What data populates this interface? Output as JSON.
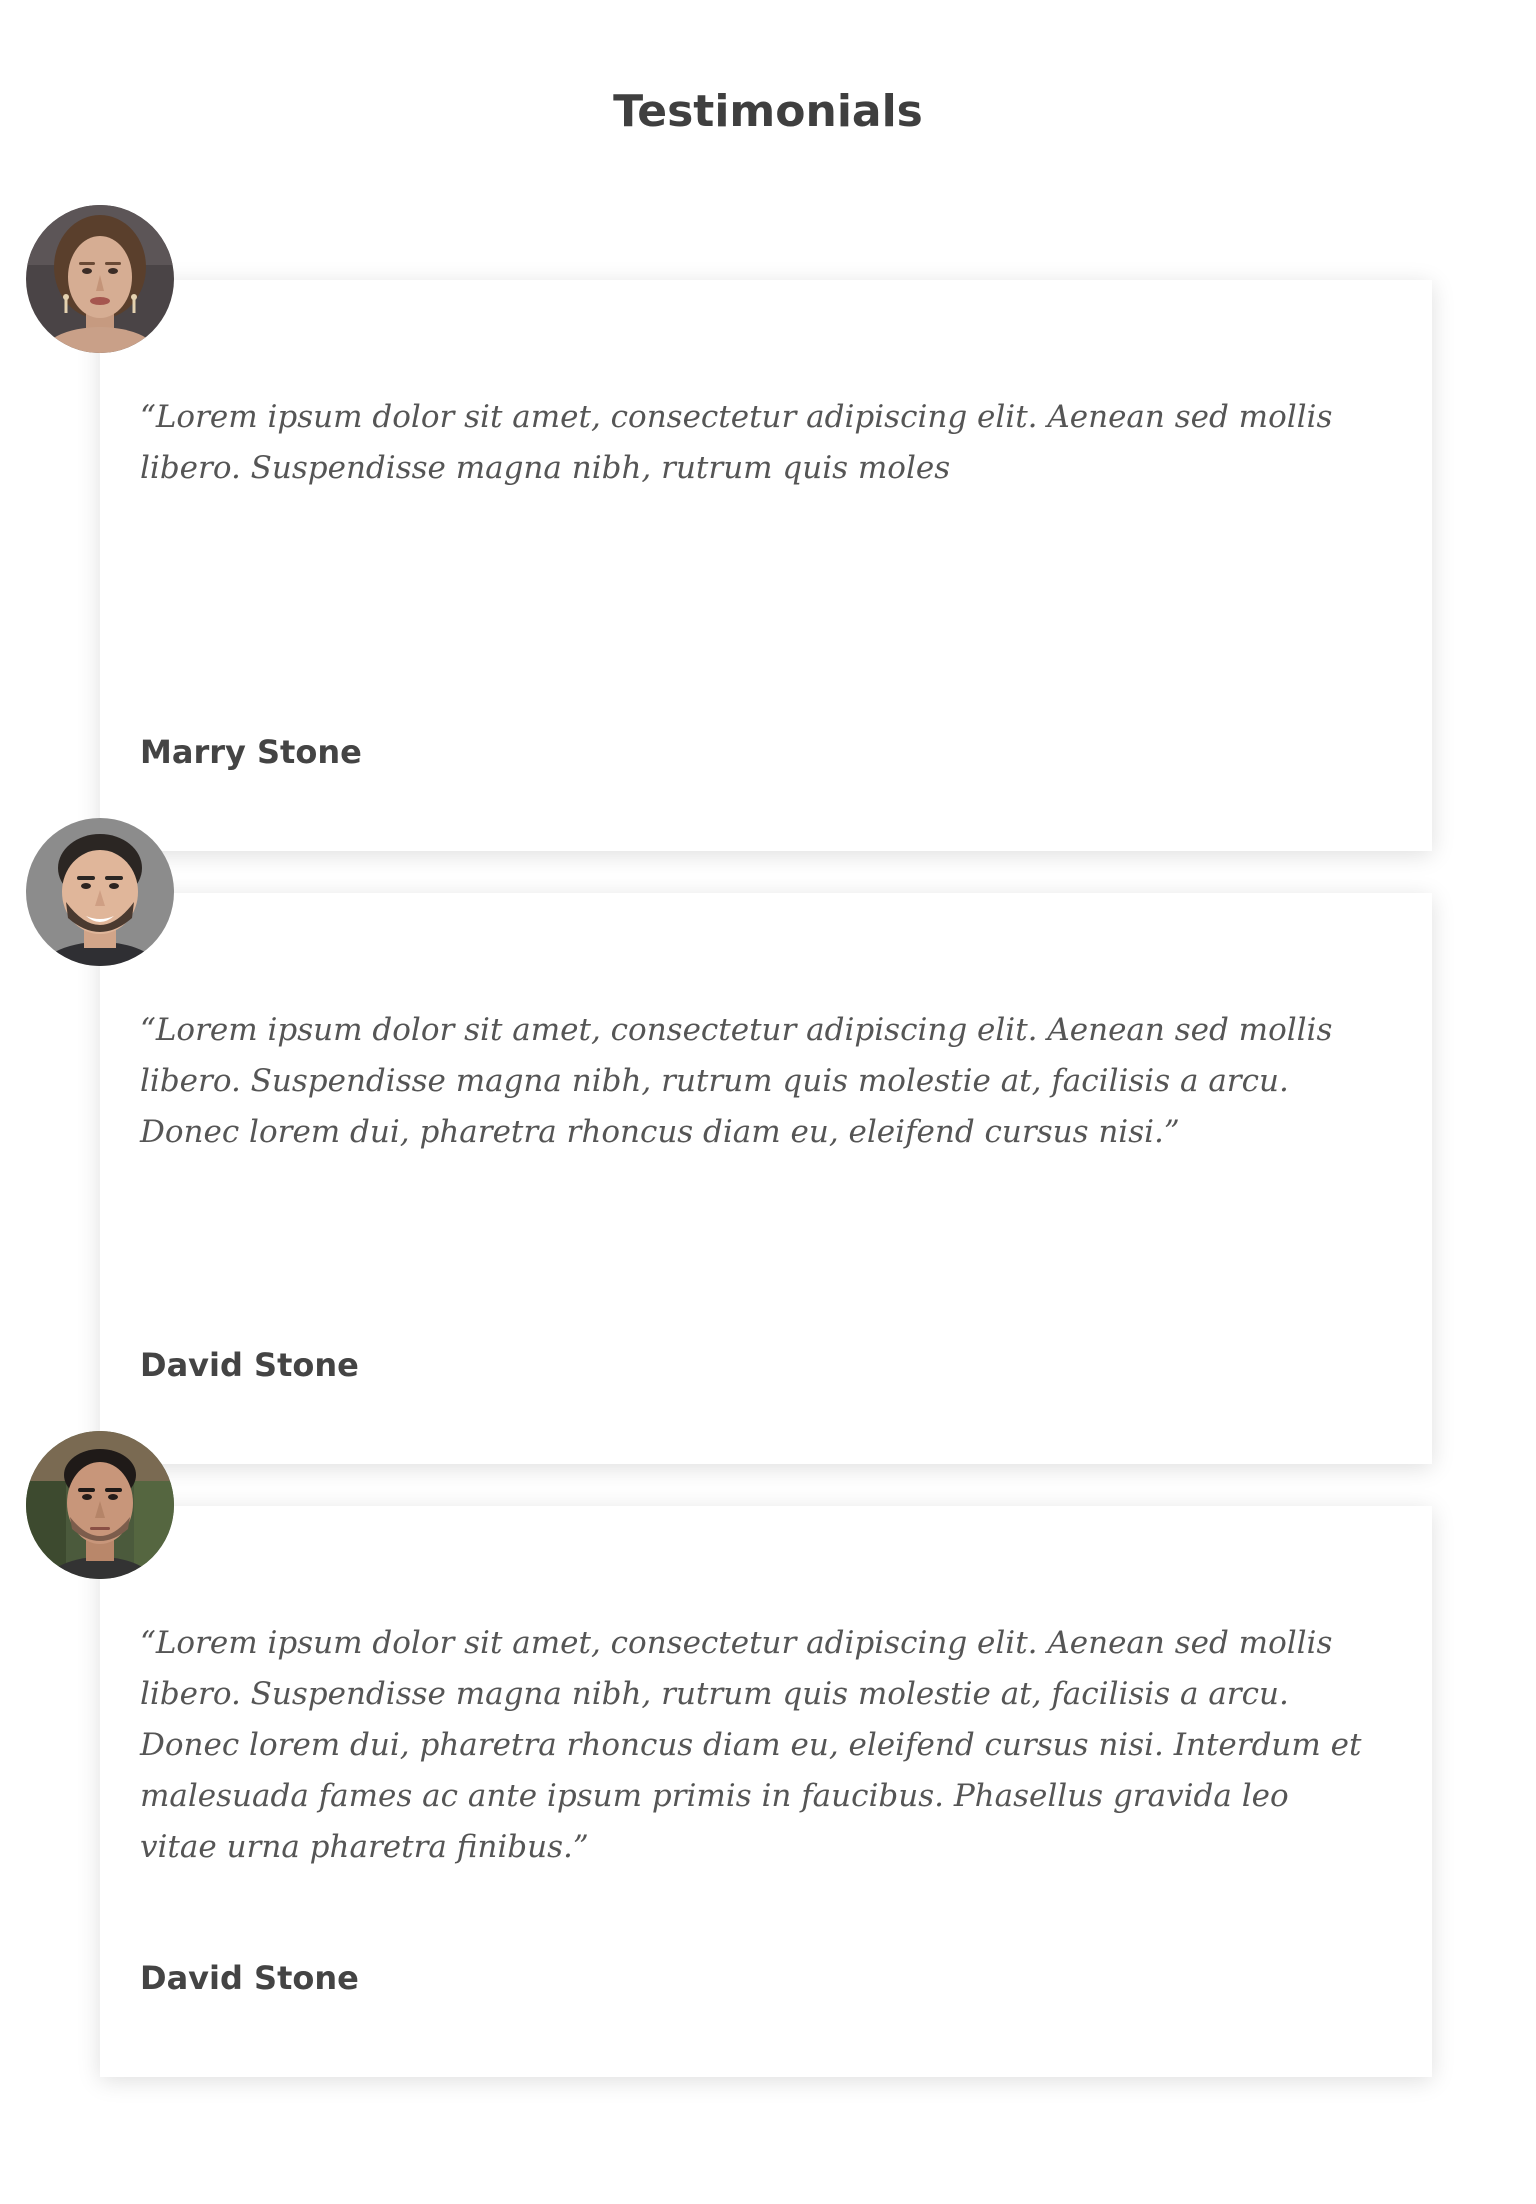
{
  "page": {
    "title": "Testimonials"
  },
  "testimonials": [
    {
      "avatar_icon": "woman-portrait",
      "quote": "“Lorem ipsum dolor sit amet, consectetur adipiscing elit. Aenean sed mollis libero. Suspendisse magna nibh, rutrum quis moles",
      "author": "Marry Stone"
    },
    {
      "avatar_icon": "man-portrait",
      "quote": "“Lorem ipsum dolor sit amet, consectetur adipiscing elit. Aenean sed mollis libero. Suspendisse magna nibh, rutrum quis molestie at, facilisis a arcu. Donec lorem dui, pharetra rhoncus diam eu, eleifend cursus nisi.”",
      "author": "David Stone"
    },
    {
      "avatar_icon": "man-portrait",
      "quote": "“Lorem ipsum dolor sit amet, consectetur adipiscing elit. Aenean sed mollis libero. Suspendisse magna nibh, rutrum quis molestie at, facilisis a arcu. Donec lorem dui, pharetra rhoncus diam eu, eleifend cursus nisi. Interdum et malesuada fames ac ante ipsum primis in faucibus. Phasellus gravida leo vitae urna pharetra finibus.”",
      "author": "David Stone"
    }
  ]
}
